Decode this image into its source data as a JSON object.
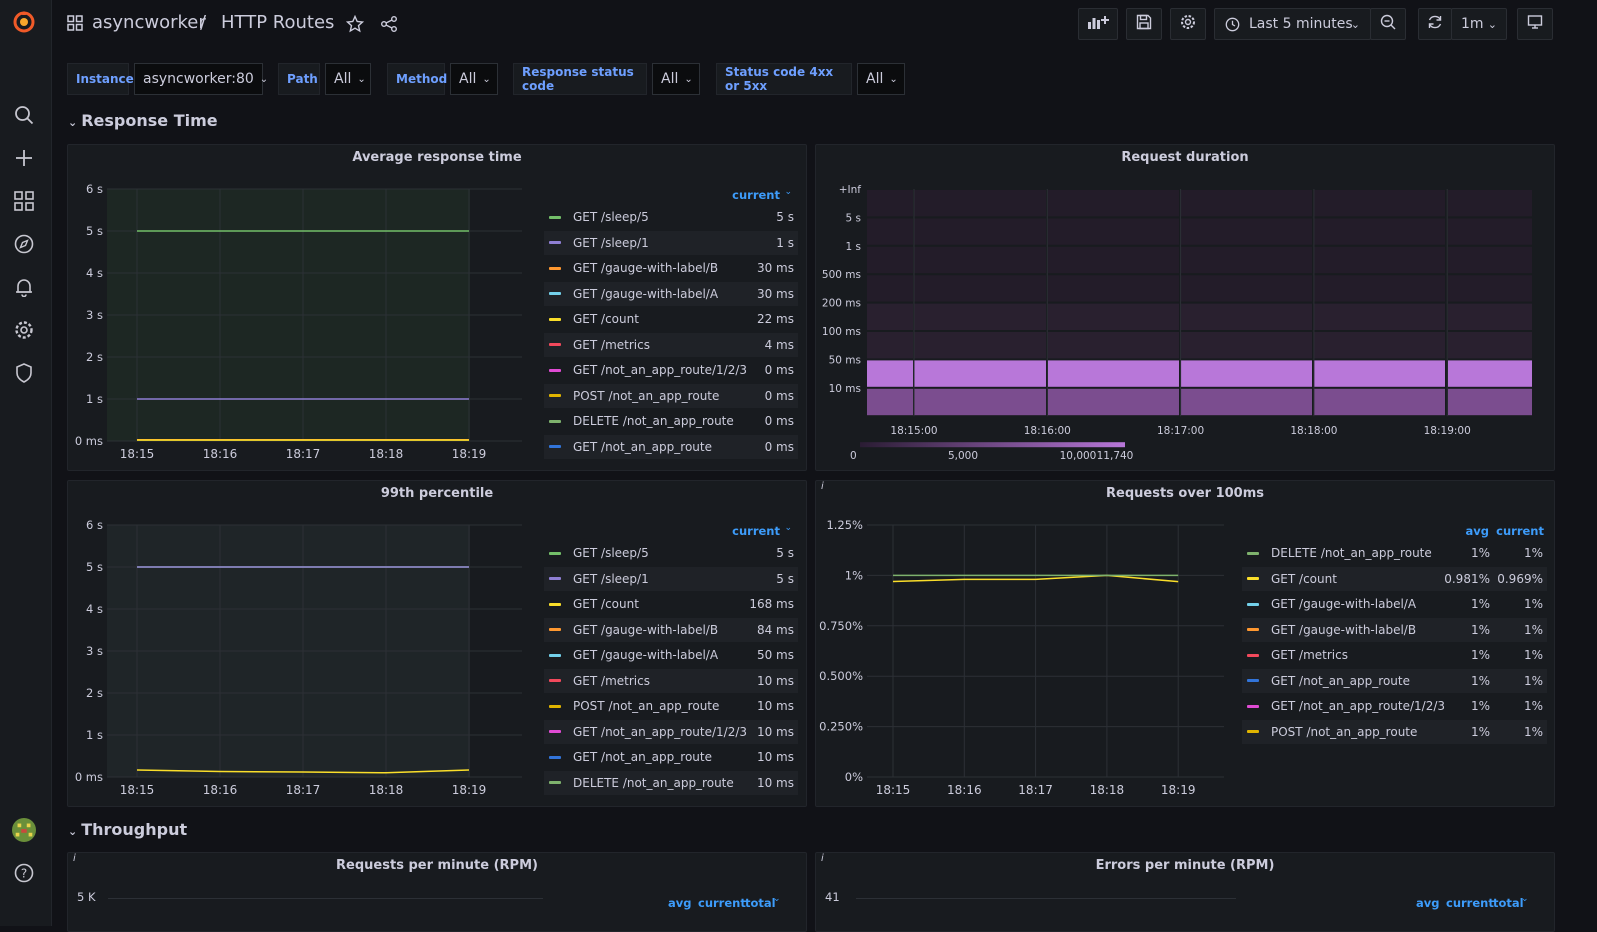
{
  "topbar": {
    "crumb_folder": "asyncworker",
    "crumb_sep": "/",
    "crumb_title": "HTTP Routes",
    "time_range": "Last 5 minutes",
    "refresh": "1m"
  },
  "variables": [
    {
      "label": "Instance",
      "value": "asyncworker:80"
    },
    {
      "label": "Path",
      "value": "All"
    },
    {
      "label": "Method",
      "value": "All"
    },
    {
      "label": "Response status code",
      "value": "All"
    },
    {
      "label": "Status code 4xx or 5xx",
      "value": "All"
    }
  ],
  "rows": {
    "response_time": "Response Time",
    "throughput": "Throughput"
  },
  "panels": {
    "avg_response": {
      "title": "Average response time",
      "legend_header": "current",
      "legend": [
        {
          "name": "GET /sleep/5",
          "value": "5 s",
          "color": "#73bf69"
        },
        {
          "name": "GET /sleep/1",
          "value": "1 s",
          "color": "#8f7fd4"
        },
        {
          "name": "GET /gauge-with-label/B",
          "value": "30 ms",
          "color": "#ff9830"
        },
        {
          "name": "GET /gauge-with-label/A",
          "value": "30 ms",
          "color": "#73d0ea"
        },
        {
          "name": "GET /count",
          "value": "22 ms",
          "color": "#fade2a"
        },
        {
          "name": "GET /metrics",
          "value": "4 ms",
          "color": "#f2495c"
        },
        {
          "name": "GET /not_an_app_route/1/2/3",
          "value": "0 ms",
          "color": "#e04bd4"
        },
        {
          "name": "POST /not_an_app_route",
          "value": "0 ms",
          "color": "#e0b400"
        },
        {
          "name": "DELETE /not_an_app_route",
          "value": "0 ms",
          "color": "#7eb26d"
        },
        {
          "name": "GET /not_an_app_route",
          "value": "0 ms",
          "color": "#3274d9"
        }
      ]
    },
    "request_duration": {
      "title": "Request duration",
      "y_buckets": [
        "+Inf",
        "5 s",
        "1 s",
        "500 ms",
        "200 ms",
        "100 ms",
        "50 ms",
        "10 ms"
      ],
      "x_ticks": [
        "18:15:00",
        "18:16:00",
        "18:17:00",
        "18:18:00",
        "18:19:00"
      ],
      "scale_labels": [
        "0",
        "5,000",
        "10,000",
        "11,740"
      ]
    },
    "p99": {
      "title": "99th percentile",
      "legend_header": "current",
      "legend": [
        {
          "name": "GET /sleep/5",
          "value": "5 s",
          "color": "#73bf69"
        },
        {
          "name": "GET /sleep/1",
          "value": "5 s",
          "color": "#8f7fd4"
        },
        {
          "name": "GET /count",
          "value": "168 ms",
          "color": "#fade2a"
        },
        {
          "name": "GET /gauge-with-label/B",
          "value": "84 ms",
          "color": "#ff9830"
        },
        {
          "name": "GET /gauge-with-label/A",
          "value": "50 ms",
          "color": "#73d0ea"
        },
        {
          "name": "GET /metrics",
          "value": "10 ms",
          "color": "#f2495c"
        },
        {
          "name": "POST /not_an_app_route",
          "value": "10 ms",
          "color": "#e0b400"
        },
        {
          "name": "GET /not_an_app_route/1/2/3",
          "value": "10 ms",
          "color": "#e04bd4"
        },
        {
          "name": "GET /not_an_app_route",
          "value": "10 ms",
          "color": "#3274d9"
        },
        {
          "name": "DELETE /not_an_app_route",
          "value": "10 ms",
          "color": "#7eb26d"
        }
      ]
    },
    "over_100ms": {
      "title": "Requests over 100ms",
      "legend_headers": [
        "avg",
        "current"
      ],
      "legend": [
        {
          "name": "DELETE /not_an_app_route",
          "avg": "1%",
          "current": "1%",
          "color": "#7eb26d"
        },
        {
          "name": "GET /count",
          "avg": "0.981%",
          "current": "0.969%",
          "color": "#fade2a"
        },
        {
          "name": "GET /gauge-with-label/A",
          "avg": "1%",
          "current": "1%",
          "color": "#73d0ea"
        },
        {
          "name": "GET /gauge-with-label/B",
          "avg": "1%",
          "current": "1%",
          "color": "#ff9830"
        },
        {
          "name": "GET /metrics",
          "avg": "1%",
          "current": "1%",
          "color": "#f2495c"
        },
        {
          "name": "GET /not_an_app_route",
          "avg": "1%",
          "current": "1%",
          "color": "#3274d9"
        },
        {
          "name": "GET /not_an_app_route/1/2/3",
          "avg": "1%",
          "current": "1%",
          "color": "#e04bd4"
        },
        {
          "name": "POST /not_an_app_route",
          "avg": "1%",
          "current": "1%",
          "color": "#e0b400"
        }
      ]
    },
    "rpm": {
      "title": "Requests per minute (RPM)",
      "y_top": "5 K",
      "legend_headers": [
        "avg",
        "current",
        "total"
      ]
    },
    "epm": {
      "title": "Errors per minute (RPM)",
      "y_top": "41",
      "legend_headers": [
        "avg",
        "current",
        "total"
      ]
    }
  },
  "chart_data": [
    {
      "type": "line",
      "title": "Average response time",
      "x": [
        "18:15",
        "18:16",
        "18:17",
        "18:18",
        "18:19"
      ],
      "y_ticks": [
        "0 ms",
        "1 s",
        "2 s",
        "3 s",
        "4 s",
        "5 s",
        "6 s"
      ],
      "ylim": [
        0,
        6
      ],
      "series": [
        {
          "name": "GET /sleep/5",
          "values": [
            5,
            5,
            5,
            5,
            5
          ]
        },
        {
          "name": "GET /sleep/1",
          "values": [
            1,
            1,
            1,
            1,
            1
          ]
        },
        {
          "name": "GET /gauge-with-label/B",
          "values": [
            0.03,
            0.03,
            0.03,
            0.03,
            0.03
          ]
        },
        {
          "name": "GET /count",
          "values": [
            0.022,
            0.022,
            0.022,
            0.022,
            0.022
          ]
        }
      ]
    },
    {
      "type": "heatmap",
      "title": "Request duration",
      "x": [
        "18:15:00",
        "18:16:00",
        "18:17:00",
        "18:18:00",
        "18:19:00"
      ],
      "y": [
        "10 ms",
        "50 ms",
        "100 ms",
        "200 ms",
        "500 ms",
        "1 s",
        "5 s",
        "+Inf"
      ],
      "scale": [
        0,
        11740
      ]
    },
    {
      "type": "line",
      "title": "99th percentile",
      "x": [
        "18:15",
        "18:16",
        "18:17",
        "18:18",
        "18:19"
      ],
      "y_ticks": [
        "0 ms",
        "1 s",
        "2 s",
        "3 s",
        "4 s",
        "5 s",
        "6 s"
      ],
      "ylim": [
        0,
        6
      ],
      "series": [
        {
          "name": "GET /sleep/5",
          "values": [
            5,
            5,
            5,
            5,
            5
          ]
        },
        {
          "name": "GET /sleep/1",
          "values": [
            5,
            5,
            5,
            5,
            5
          ]
        },
        {
          "name": "GET /count",
          "values": [
            0.168,
            0.13,
            0.12,
            0.1,
            0.168
          ]
        }
      ]
    },
    {
      "type": "line",
      "title": "Requests over 100ms",
      "x": [
        "18:15",
        "18:16",
        "18:17",
        "18:18",
        "18:19"
      ],
      "y_ticks": [
        "0%",
        "0.250%",
        "0.500%",
        "0.750%",
        "1%",
        "1.25%"
      ],
      "ylim": [
        0,
        1.25
      ],
      "series": [
        {
          "name": "GET /count",
          "values": [
            0.97,
            0.98,
            0.98,
            1,
            0.969
          ]
        },
        {
          "name": "DELETE /not_an_app_route",
          "values": [
            1,
            1,
            1,
            1,
            1
          ]
        }
      ]
    }
  ]
}
